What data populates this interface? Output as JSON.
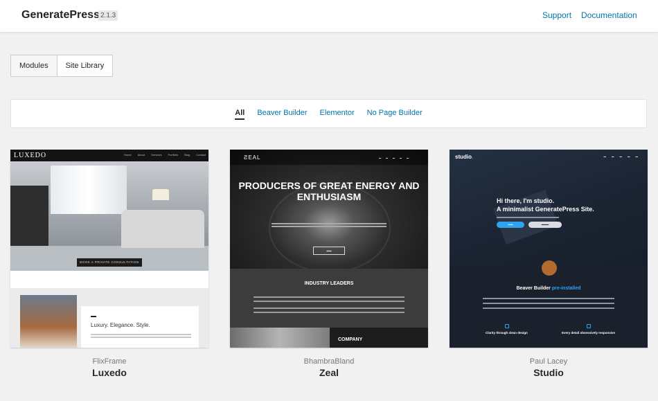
{
  "header": {
    "brand": "GeneratePress",
    "version": "2.1.3",
    "links": {
      "support": "Support",
      "documentation": "Documentation"
    }
  },
  "tabs": {
    "modules": "Modules",
    "site_library": "Site Library",
    "active": "Site Library"
  },
  "filters": {
    "all": "All",
    "beaver": "Beaver Builder",
    "elementor": "Elementor",
    "none": "No Page Builder",
    "active": "All"
  },
  "sites": [
    {
      "author": "FlixFrame",
      "name": "Luxedo",
      "preview": {
        "logo": "LUXEDO",
        "menu": [
          "Home",
          "About",
          "Services",
          "Portfolio",
          "Blog",
          "Contact"
        ],
        "cta": "BOOK A PRIVATE CONSULTATION",
        "tagline": "Luxury. Elegance. Style."
      }
    },
    {
      "author": "BhambraBland",
      "name": "Zeal",
      "preview": {
        "logo": "ƧEAL",
        "headline": "PRODUCERS OF GREAT ENERGY AND ENTHUSIASM",
        "section": "INDUSTRY LEADERS",
        "footer": "COMPANY"
      }
    },
    {
      "author": "Paul Lacey",
      "name": "Studio",
      "preview": {
        "logo": "studio",
        "logo_dot": ".",
        "hero_line1": "Hi there, I'm studio.",
        "hero_line2": "A minimalist GeneratePress Site.",
        "feature": "Beaver Builder",
        "feature_accent": "pre-installed",
        "col1": "Clarity through clean design",
        "col2": "Every detail obsessively responsive"
      }
    }
  ],
  "colors": {
    "link": "#0073aa",
    "accent_blue": "#2ea3f2",
    "background": "#f1f1f1"
  }
}
